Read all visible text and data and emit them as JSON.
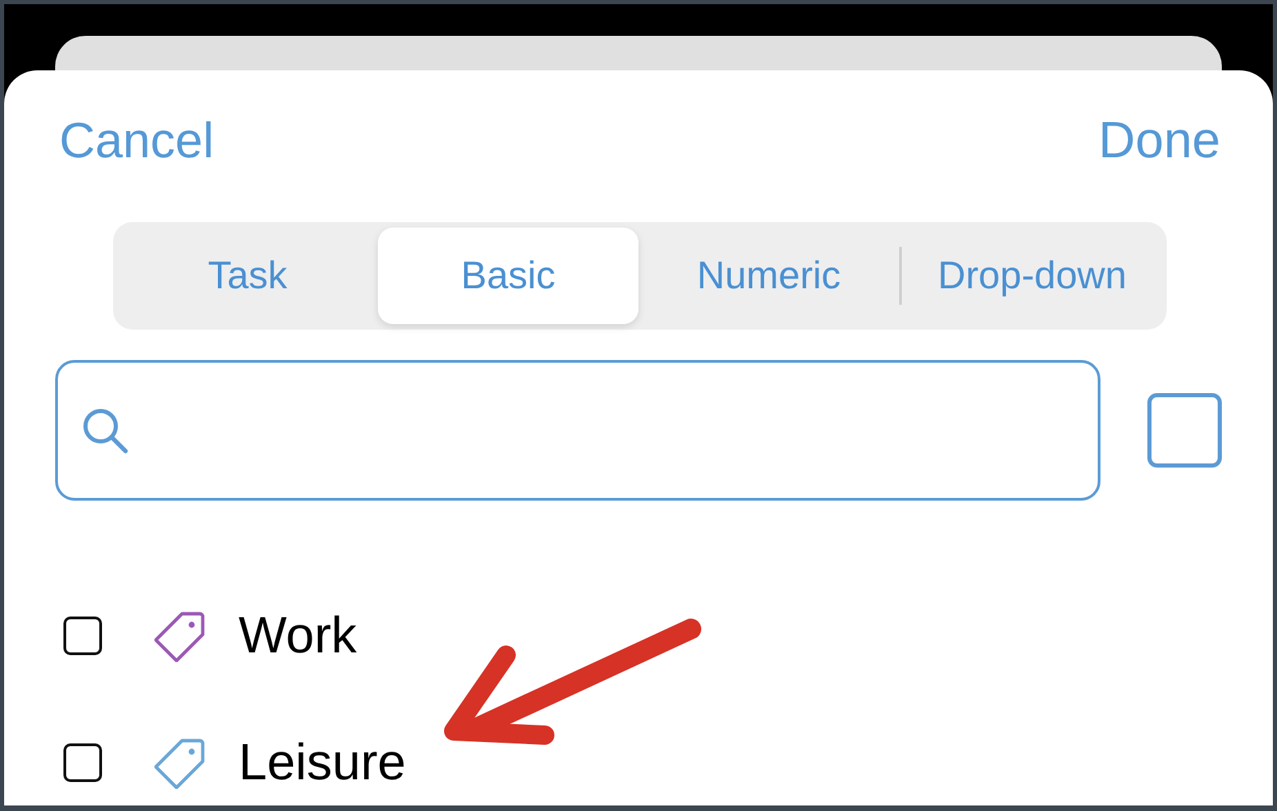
{
  "nav": {
    "cancel": "Cancel",
    "done": "Done"
  },
  "tabs": [
    {
      "label": "Task",
      "selected": false
    },
    {
      "label": "Basic",
      "selected": true
    },
    {
      "label": "Numeric",
      "selected": false
    },
    {
      "label": "Drop-down",
      "selected": false
    }
  ],
  "select_all": {
    "checked": false
  },
  "tags": [
    {
      "label": "Work",
      "checked": false,
      "color": "#9b59b6"
    },
    {
      "label": "Leisure",
      "checked": false,
      "color": "#6aa7d8"
    }
  ]
}
